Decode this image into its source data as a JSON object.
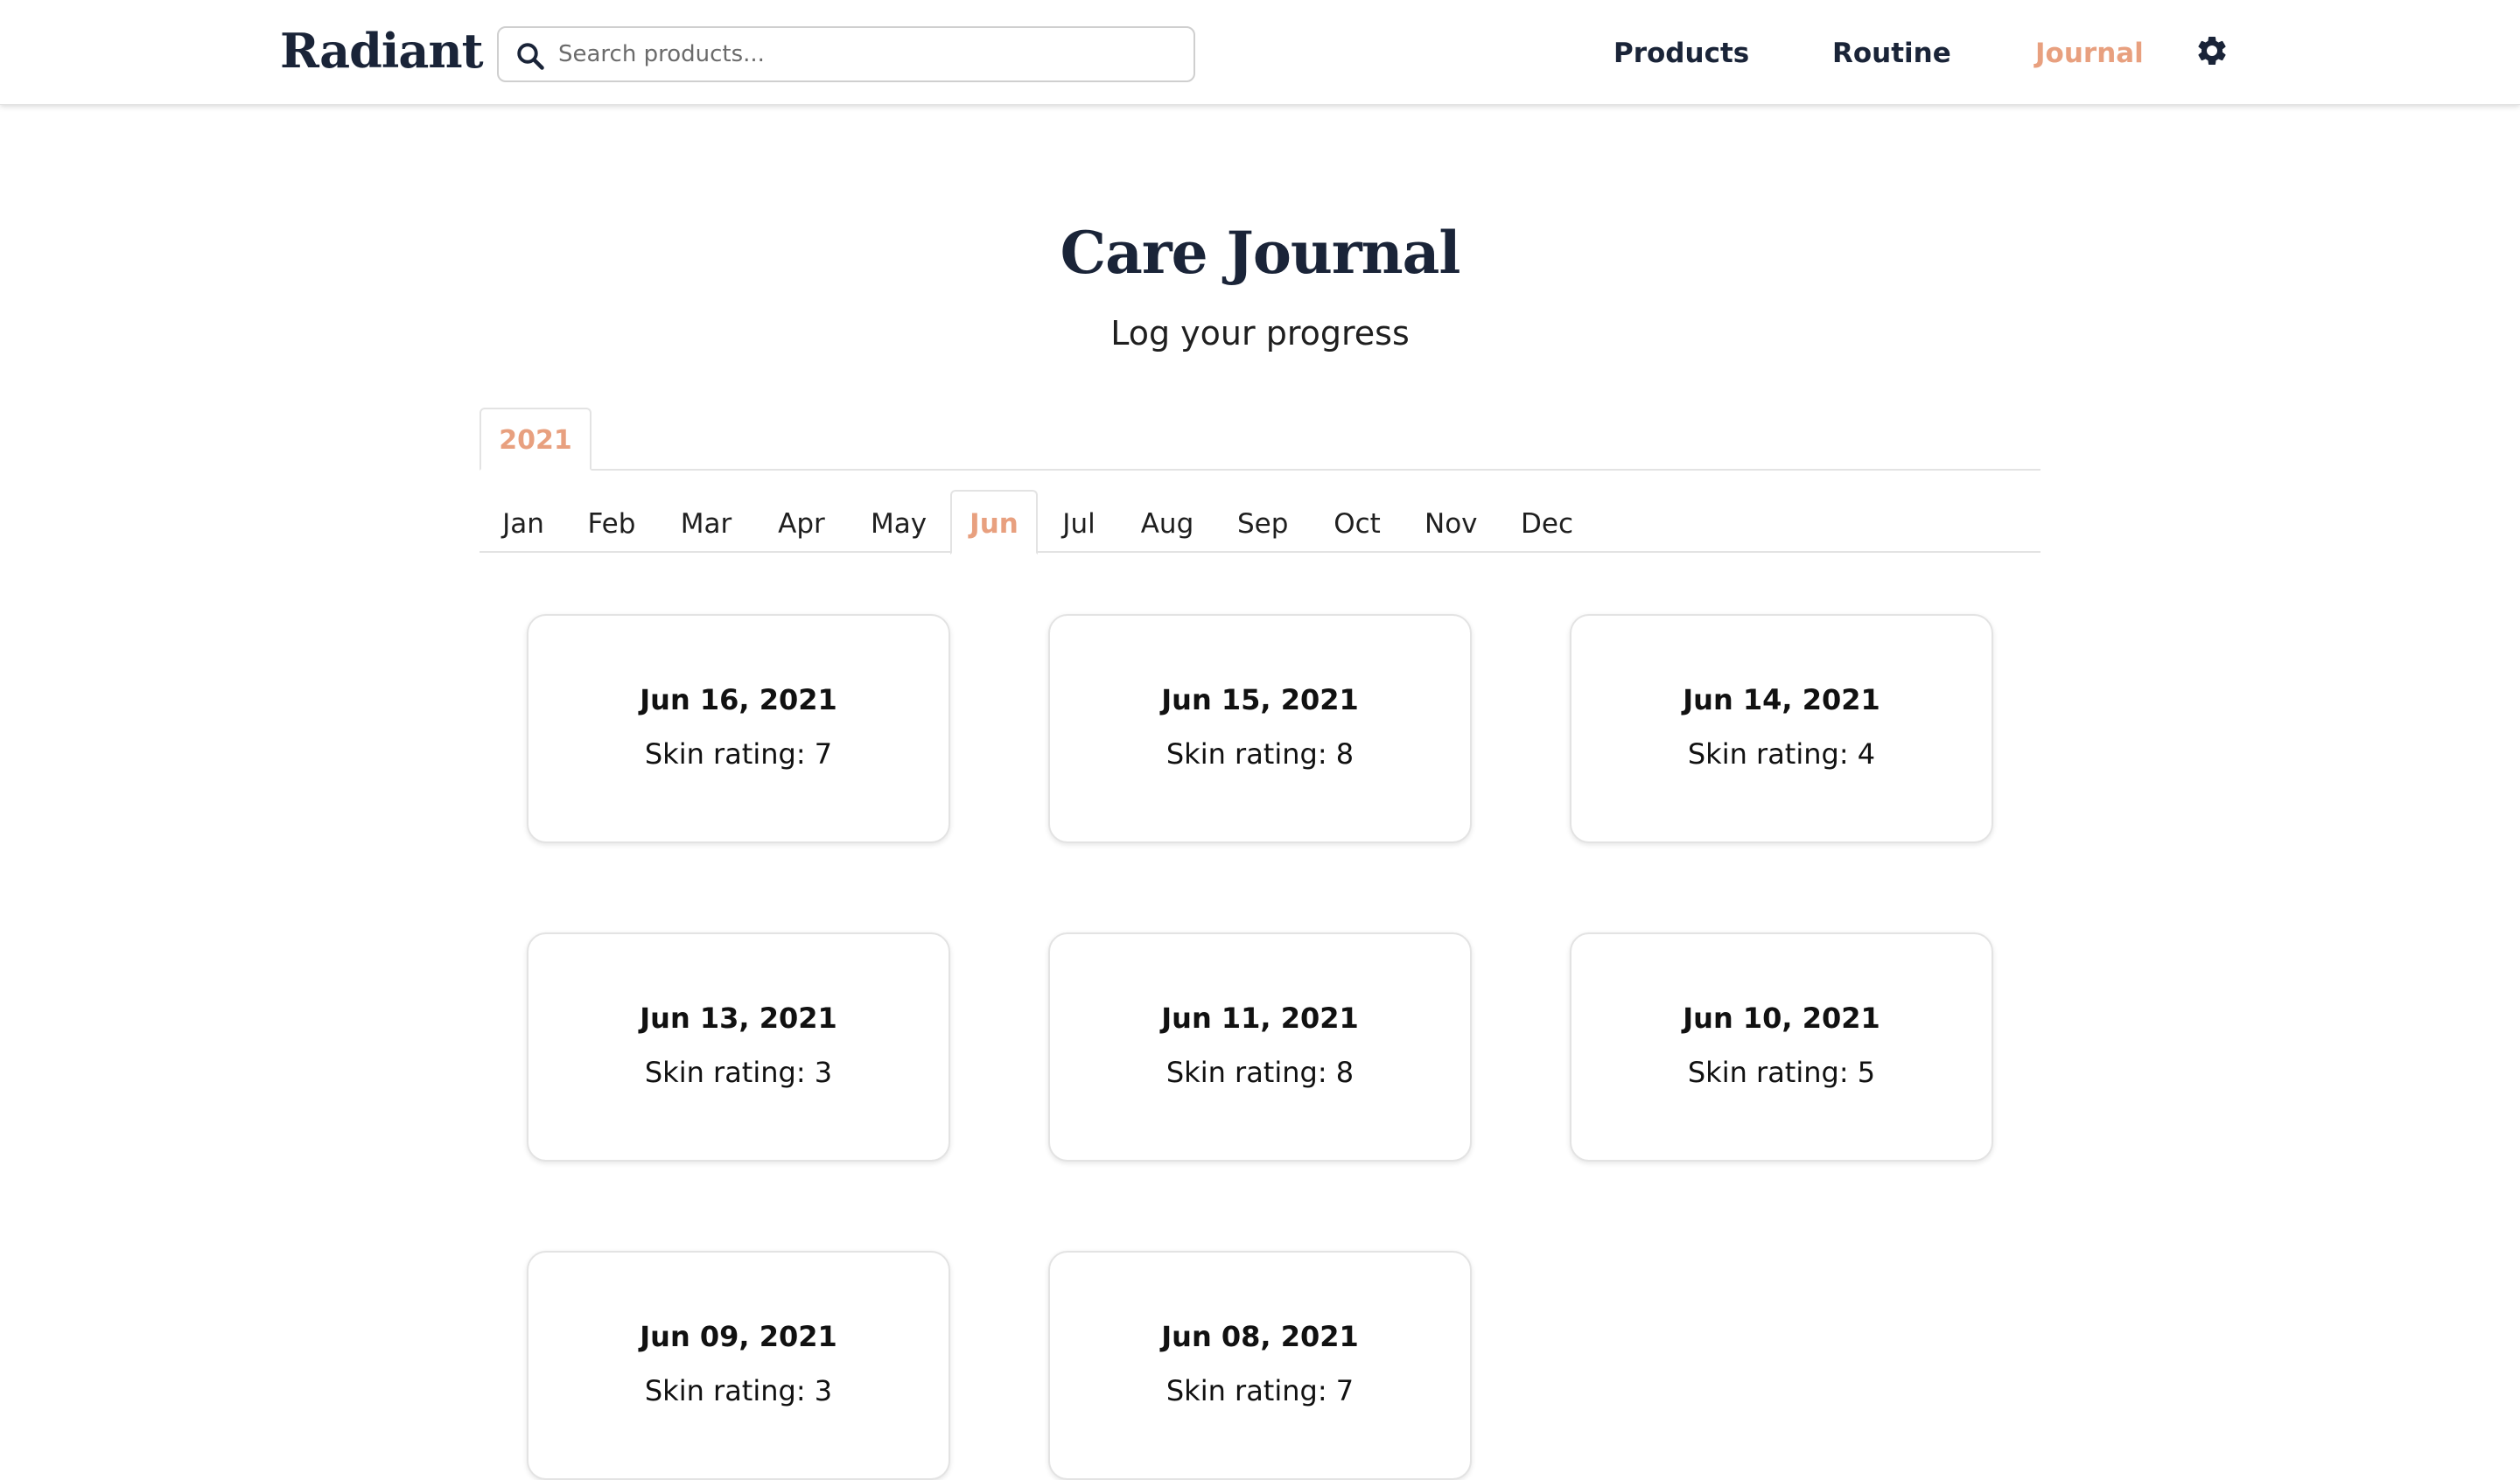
{
  "header": {
    "logo": "Radiant",
    "search": {
      "placeholder": "Search products...",
      "value": ""
    },
    "nav": [
      {
        "label": "Products",
        "active": false
      },
      {
        "label": "Routine",
        "active": false
      },
      {
        "label": "Journal",
        "active": true
      }
    ],
    "settings_icon": "gear-icon",
    "search_icon": "search-icon"
  },
  "page": {
    "title": "Care Journal",
    "subtitle": "Log your progress"
  },
  "years": [
    {
      "label": "2021",
      "active": true
    }
  ],
  "months": [
    {
      "label": "Jan",
      "active": false
    },
    {
      "label": "Feb",
      "active": false
    },
    {
      "label": "Mar",
      "active": false
    },
    {
      "label": "Apr",
      "active": false
    },
    {
      "label": "May",
      "active": false
    },
    {
      "label": "Jun",
      "active": true
    },
    {
      "label": "Jul",
      "active": false
    },
    {
      "label": "Aug",
      "active": false
    },
    {
      "label": "Sep",
      "active": false
    },
    {
      "label": "Oct",
      "active": false
    },
    {
      "label": "Nov",
      "active": false
    },
    {
      "label": "Dec",
      "active": false
    }
  ],
  "entries": [
    {
      "date": "Jun 16, 2021",
      "rating": "Skin rating: 7"
    },
    {
      "date": "Jun 15, 2021",
      "rating": "Skin rating: 8"
    },
    {
      "date": "Jun 14, 2021",
      "rating": "Skin rating: 4"
    },
    {
      "date": "Jun 13, 2021",
      "rating": "Skin rating: 3"
    },
    {
      "date": "Jun 11, 2021",
      "rating": "Skin rating: 8"
    },
    {
      "date": "Jun 10, 2021",
      "rating": "Skin rating: 5"
    },
    {
      "date": "Jun 09, 2021",
      "rating": "Skin rating: 3"
    },
    {
      "date": "Jun 08, 2021",
      "rating": "Skin rating: 7"
    }
  ],
  "colors": {
    "accent": "#e8a07f",
    "navy": "#1a2438",
    "border": "#e3e3e3"
  }
}
